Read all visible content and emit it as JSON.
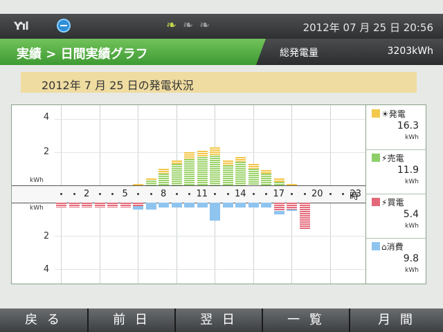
{
  "status": {
    "signal_glyph": "Ƴıl",
    "network_icon": "network-icon",
    "leaf_icons": [
      "leaf-icon",
      "leaf-icon",
      "leaf-icon"
    ],
    "datetime": "2012年 07 月 25 日  20:56"
  },
  "header": {
    "breadcrumb": "実績 > 日間実績グラフ",
    "total_label": "総発電量",
    "total_value": "3203kWh"
  },
  "main": {
    "title": "2012年   7 月 25 日の発電状況"
  },
  "graph": {
    "y_ticks_top": [
      "4",
      "2"
    ],
    "y_ticks_bottom": [
      "2",
      "4"
    ],
    "unit": "kWh",
    "x_labels": [
      "2",
      "5",
      "8",
      "11",
      "14",
      "17",
      "20",
      "23"
    ],
    "x_suffix": "時"
  },
  "legend": [
    {
      "name": "発電",
      "value": "16.3",
      "unit": "kWh",
      "color": "#f2c94c",
      "icon": "sun-icon"
    },
    {
      "name": "売電",
      "value": "11.9",
      "unit": "kWh",
      "color": "#8fcf6a",
      "icon": "tower-icon"
    },
    {
      "name": "買電",
      "value": "5.4",
      "unit": "kWh",
      "color": "#e46a7a",
      "icon": "tower-icon"
    },
    {
      "name": "消費",
      "value": "9.8",
      "unit": "kWh",
      "color": "#8fc4ef",
      "icon": "house-icon"
    }
  ],
  "chart_data": {
    "type": "bar",
    "categories": [
      "0",
      "1",
      "2",
      "3",
      "4",
      "5",
      "6",
      "7",
      "8",
      "9",
      "10",
      "11",
      "12",
      "13",
      "14",
      "15",
      "16",
      "17",
      "18",
      "19",
      "20",
      "21",
      "22",
      "23"
    ],
    "series": [
      {
        "name": "発電",
        "values": [
          0,
          0,
          0,
          0,
          0,
          0,
          0.1,
          0.4,
          1.0,
          1.5,
          2.0,
          2.1,
          2.3,
          1.5,
          1.7,
          1.3,
          0.9,
          0.4,
          0.1,
          0,
          0,
          0,
          0,
          0
        ]
      },
      {
        "name": "売電",
        "values": [
          0,
          0,
          0,
          0,
          0,
          0,
          0,
          0.3,
          0.7,
          1.3,
          1.6,
          1.7,
          1.8,
          1.2,
          1.4,
          1.0,
          0.7,
          0.2,
          0,
          0,
          0,
          0,
          0,
          0
        ]
      },
      {
        "name": "買電",
        "values": [
          0.3,
          0.3,
          0.3,
          0.3,
          0.3,
          0.3,
          0.2,
          0,
          0,
          0,
          0,
          0,
          0,
          0,
          0,
          0,
          0,
          0.5,
          0.4,
          1.6,
          0,
          0,
          0,
          0
        ]
      },
      {
        "name": "消費",
        "values": [
          0.3,
          0.3,
          0.3,
          0.3,
          0.3,
          0.3,
          0.4,
          0.4,
          0.3,
          0.3,
          0.3,
          0.3,
          1.1,
          0.3,
          0.3,
          0.3,
          0.3,
          0.7,
          0.5,
          1.6,
          0,
          0,
          0,
          0
        ]
      }
    ],
    "ylim": [
      -4.5,
      4.5
    ]
  },
  "nav": {
    "buttons": [
      "戻 る",
      "前 日",
      "翌 日",
      "一 覧",
      "月 間"
    ]
  }
}
